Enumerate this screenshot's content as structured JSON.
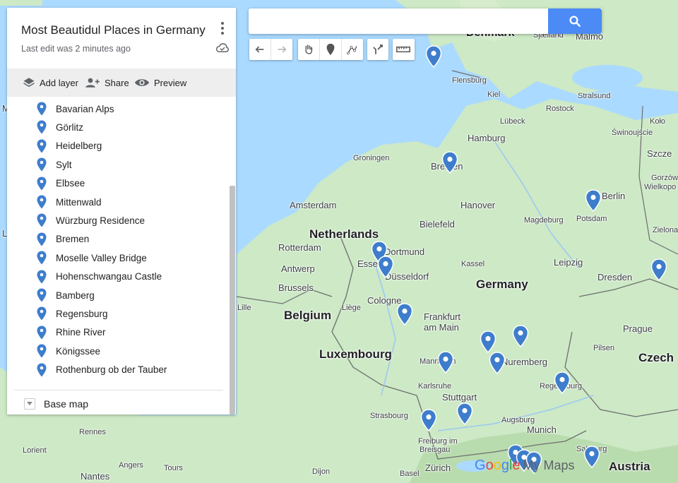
{
  "map_title": "Most Beautidul Places in Germany",
  "last_edit": "Last edit was 2 minutes ago",
  "actions": {
    "add_layer": "Add layer",
    "share": "Share",
    "preview": "Preview"
  },
  "places": [
    "Bavarian Alps",
    "Görlitz",
    "Heidelberg",
    "Sylt",
    "Elbsee",
    "Mittenwald",
    "Würzburg Residence",
    "Bremen",
    "Moselle Valley Bridge",
    "Hohenschwangau Castle",
    "Bamberg",
    "Regensburg",
    "Rhine River",
    "Königssee",
    "Rothenburg ob der Tauber"
  ],
  "base_map": "Base map",
  "search": {
    "value": "",
    "placeholder": ""
  },
  "brand": {
    "g": "G",
    "o1": "o",
    "o2": "o",
    "g2": "g",
    "l": "l",
    "e": "e",
    "mymaps": "My Maps"
  },
  "colors": {
    "water": "#aadaff",
    "land": "#cde9c6",
    "pin": "#3e7dcc",
    "search_button": "#4c8bf5"
  },
  "map_labels": {
    "denmark": "Denmark",
    "sjaelland": "Sjælland",
    "malmo": "Malmö",
    "flensburg": "Flensburg",
    "kiel": "Kiel",
    "stralsund": "Stralsund",
    "rostock": "Rostock",
    "lubeck": "Lübeck",
    "swinoujscie": "Świnoujście",
    "kolo": "Koło",
    "szczecin": "Szcze",
    "hamburg": "Hamburg",
    "groningen": "Groningen",
    "bremen": "Bremen",
    "berlin": "Berlin",
    "gorzow": "Gorzów",
    "wielkopolski": "Wielkopo",
    "zielona": "Zielona",
    "amsterdam": "Amsterdam",
    "hanover": "Hanover",
    "potsdam": "Potsdam",
    "magdeburg": "Magdeburg",
    "netherlands": "Netherlands",
    "bielefeld": "Bielefeld",
    "rotterdam": "Rotterdam",
    "dortmund": "Dortmund",
    "essen": "Essen",
    "antwerp": "Antwerp",
    "dusseldorf": "Düsseldorf",
    "kassel": "Kassel",
    "leipzig": "Leipzig",
    "brussels": "Brussels",
    "germany": "Germany",
    "dresden": "Dresden",
    "lille": "Lille",
    "belgium": "Belgium",
    "liege": "Liège",
    "cologne": "Cologne",
    "frankfurt": "Frankfurt",
    "am_main": "am Main",
    "prague": "Prague",
    "luxembourg": "Luxembourg",
    "pilsen": "Pilsen",
    "czech": "Czech",
    "mannheim": "Mannheim",
    "nuremberg": "Nuremberg",
    "karlsruhe": "Karlsruhe",
    "stuttgart": "Stuttgart",
    "regensburg": "Regensburg",
    "strasbourg": "Strasbourg",
    "augsburg": "Augsburg",
    "munich": "Munich",
    "freiburg": "Freiburg im",
    "breisgau": "Breisgau",
    "salzburg": "Salzburg",
    "rennes": "Rennes",
    "lorient": "Lorient",
    "angers": "Angers",
    "tours": "Tours",
    "nantes": "Nantes",
    "dijon": "Dijon",
    "basel": "Basel",
    "zurich": "Zürich",
    "austria": "Austria",
    "edge_m": "M",
    "edge_l": "L"
  }
}
